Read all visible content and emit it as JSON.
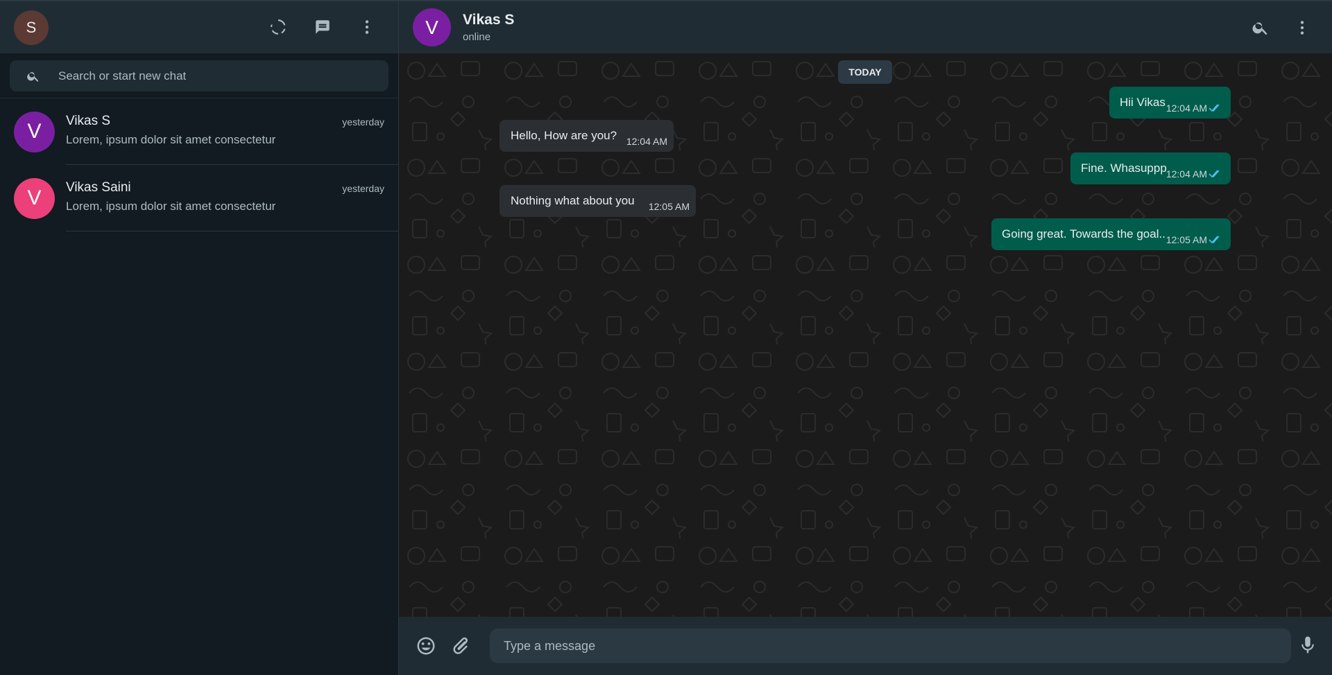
{
  "sidebar": {
    "self_avatar_letter": "S",
    "search": {
      "placeholder": "Search or start new chat"
    },
    "chats": [
      {
        "avatar_letter": "V",
        "name": "Vikas S",
        "time": "yesterday",
        "preview": "Lorem, ipsum dolor sit amet consectetur",
        "avatar_color": "#7b1fa2"
      },
      {
        "avatar_letter": "V",
        "name": "Vikas Saini",
        "time": "yesterday",
        "preview": "Lorem, ipsum dolor sit amet consectetur",
        "avatar_color": "#ec407a"
      }
    ],
    "icons": [
      "status-icon",
      "new-chat-icon",
      "menu-icon",
      "search-icon"
    ]
  },
  "conversation": {
    "avatar_letter": "V",
    "name": "Vikas S",
    "status": "online",
    "date_chip": "TODAY",
    "messages": [
      {
        "direction": "out",
        "text": "Hii Vikas",
        "time": "12:04 AM"
      },
      {
        "direction": "in",
        "text": "Hello, How are you?",
        "time": "12:04 AM"
      },
      {
        "direction": "out",
        "text": "Fine. Whasuppp",
        "time": "12:04 AM"
      },
      {
        "direction": "in",
        "text": "Nothing what about you",
        "time": "12:05 AM"
      },
      {
        "direction": "out",
        "text": "Going great. Towards the goal..",
        "time": "12:05 AM"
      }
    ],
    "composer": {
      "placeholder": "Type a message"
    },
    "icons": [
      "search-icon",
      "menu-icon",
      "emoji-icon",
      "attach-icon",
      "mic-icon",
      "double-check-icon"
    ]
  },
  "colors": {
    "sidebar_bg": "#111b21",
    "header_bg": "#202c33",
    "incoming_bubble": "#2b2f33",
    "outgoing_bubble": "#005c4b",
    "read_ticks": "#53bdeb"
  }
}
